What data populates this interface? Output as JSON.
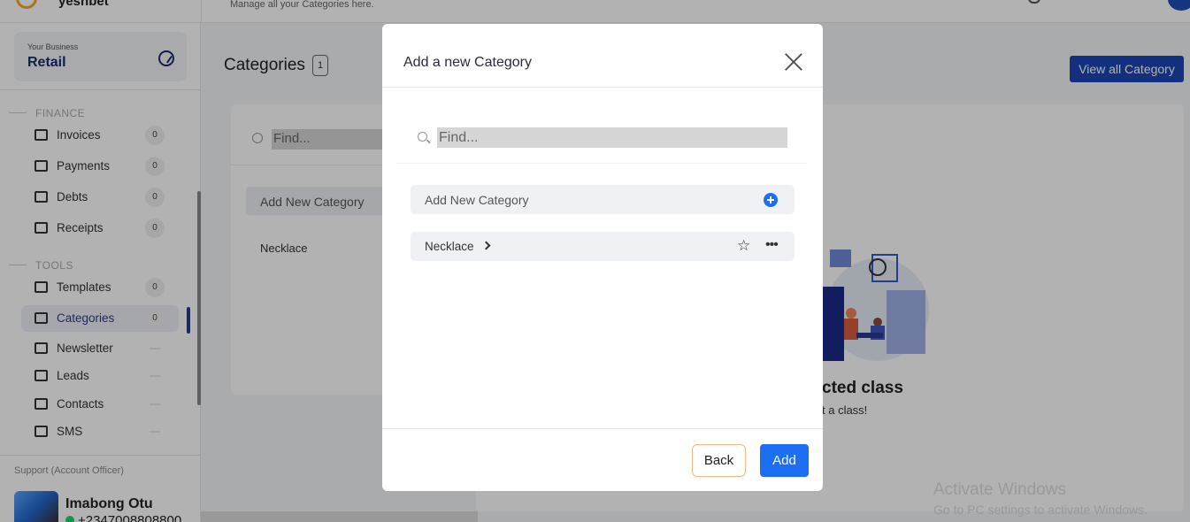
{
  "app": {
    "subtitle": "Manage all your Categories here.",
    "brand_partial": "yesnbet"
  },
  "sidebar": {
    "business_label": "Your Business",
    "business_name": "Retail",
    "sections": [
      {
        "heading": "FINANCE",
        "items": [
          {
            "label": "Invoices",
            "count": "0",
            "icon": "invoice-icon"
          },
          {
            "label": "Payments",
            "count": "0",
            "icon": "payment-icon"
          },
          {
            "label": "Debts",
            "count": "0",
            "icon": "debt-icon"
          },
          {
            "label": "Receipts",
            "count": "0",
            "icon": "receipt-icon"
          }
        ]
      },
      {
        "heading": "TOOLS",
        "items": [
          {
            "label": "Templates",
            "count": "0",
            "icon": "template-icon"
          },
          {
            "label": "Categories",
            "count": "0",
            "icon": "categories-icon",
            "active": true
          },
          {
            "label": "Newsletter",
            "count": "",
            "icon": "newsletter-icon"
          },
          {
            "label": "Leads",
            "count": "",
            "icon": "leads-icon"
          },
          {
            "label": "Contacts",
            "count": "",
            "icon": "contacts-icon"
          },
          {
            "label": "SMS",
            "count": "",
            "icon": "sms-icon"
          }
        ]
      }
    ],
    "support": {
      "label": "Support (Account Officer)",
      "name": "Imabong Otu",
      "phone": "+2347008808800"
    }
  },
  "main": {
    "title": "Categories",
    "count": "1",
    "view_all_label": "View all Category",
    "search_placeholder": "Find...",
    "add_new_label": "Add New Category",
    "items": [
      "Necklace"
    ],
    "empty_title": "cted class",
    "empty_subtitle": "t a class!"
  },
  "modal": {
    "title": "Add a new Category",
    "search_placeholder": "Find...",
    "add_new_label": "Add New Category",
    "items": [
      {
        "label": "Necklace"
      }
    ],
    "back_label": "Back",
    "add_label": "Add"
  },
  "watermark": {
    "line1": "Activate Windows",
    "line2": "Go to PC settings to activate Windows."
  },
  "colors": {
    "accent": "#1c6ef2",
    "brand_dark": "#1a45b4",
    "sidebar_active": "#2a3a8c"
  }
}
